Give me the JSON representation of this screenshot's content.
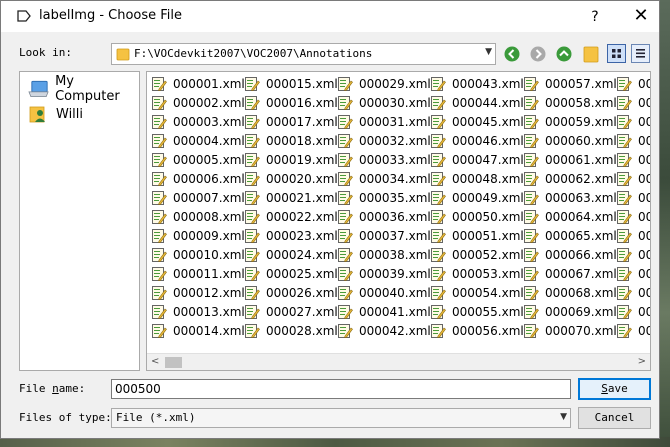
{
  "window": {
    "title": "labelImg - Choose File",
    "help_label": "?",
    "close_label": "✕"
  },
  "toolbar": {
    "look_in_label": "Look in:",
    "path": "F:\\VOCdevkit2007\\VOC2007\\Annotations",
    "icons": [
      "back-icon",
      "forward-icon",
      "up-icon",
      "new-folder-icon",
      "list-view-icon",
      "detail-view-icon"
    ]
  },
  "places": [
    {
      "label": "My Computer",
      "icon": "computer-icon"
    },
    {
      "label": "Willi",
      "icon": "user-folder-icon"
    }
  ],
  "files": [
    "000001.xml",
    "000002.xml",
    "000003.xml",
    "000004.xml",
    "000005.xml",
    "000006.xml",
    "000007.xml",
    "000008.xml",
    "000009.xml",
    "000010.xml",
    "000011.xml",
    "000012.xml",
    "000013.xml",
    "000014.xml",
    "000015.xml",
    "000016.xml",
    "000017.xml",
    "000018.xml",
    "000019.xml",
    "000020.xml",
    "000021.xml",
    "000022.xml",
    "000023.xml",
    "000024.xml",
    "000025.xml",
    "000026.xml",
    "000027.xml",
    "000028.xml",
    "000029.xml",
    "000030.xml",
    "000031.xml",
    "000032.xml",
    "000033.xml",
    "000034.xml",
    "000035.xml",
    "000036.xml",
    "000037.xml",
    "000038.xml",
    "000039.xml",
    "000040.xml",
    "000041.xml",
    "000042.xml",
    "000043.xml",
    "000044.xml",
    "000045.xml",
    "000046.xml",
    "000047.xml",
    "000048.xml",
    "000049.xml",
    "000050.xml",
    "000051.xml",
    "000052.xml",
    "000053.xml",
    "000054.xml",
    "000055.xml",
    "000056.xml",
    "000057.xml",
    "000058.xml",
    "000059.xml",
    "000060.xml",
    "000061.xml",
    "000062.xml",
    "000063.xml",
    "000064.xml",
    "000065.xml",
    "000066.xml",
    "000067.xml",
    "000068.xml",
    "000069.xml",
    "000070.xml",
    "00",
    "00",
    "00",
    "00",
    "00",
    "00",
    "00",
    "00",
    "00",
    "00",
    "00",
    "00",
    "00",
    "00"
  ],
  "file_name": {
    "label_prefix": "File ",
    "label_accel": "n",
    "label_suffix": "ame:",
    "value": "000500"
  },
  "file_type": {
    "label": "Files of type:",
    "value": "File (*.xml)"
  },
  "buttons": {
    "save_accel": "S",
    "save_rest": "ave",
    "cancel": "Cancel"
  },
  "colors": {
    "accent": "#0078d7",
    "folder": "#f5c242",
    "nav_green": "#3a9a3a"
  }
}
